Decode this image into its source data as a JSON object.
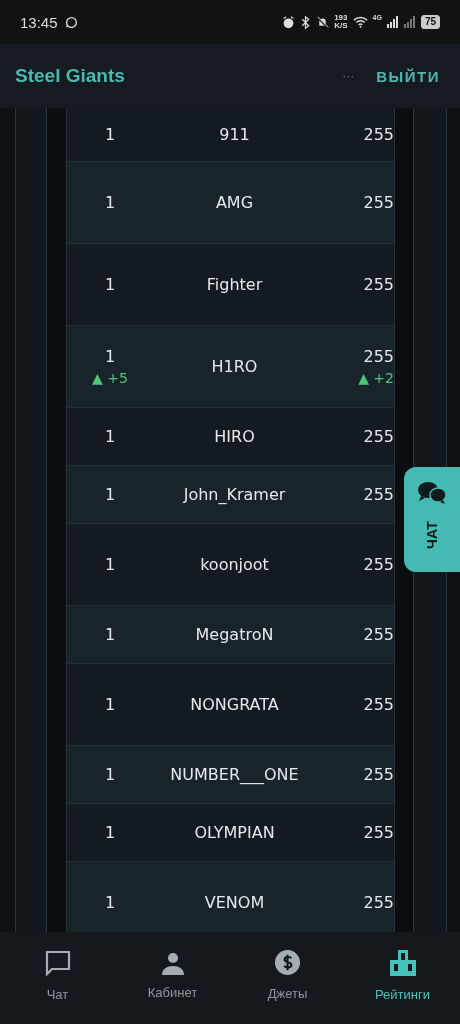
{
  "status_bar": {
    "time": "13:45",
    "speed": "193",
    "speed_unit": "K/S",
    "network": "4G",
    "battery": "75"
  },
  "header": {
    "title": "Steel Giants",
    "more": "···",
    "logout": "ВЫЙТИ"
  },
  "rows": [
    {
      "rank": "1",
      "name": "911",
      "score": "255",
      "tall": false
    },
    {
      "rank": "1",
      "name": "AMG",
      "score": "255",
      "tall": true
    },
    {
      "rank": "1",
      "name": "Fighter",
      "score": "255",
      "tall": true
    },
    {
      "rank": "1",
      "rank_change": "▲ +5",
      "name": "H1RO",
      "score": "255",
      "score_change": "▲ +2",
      "tall": true
    },
    {
      "rank": "1",
      "name": "HIRO",
      "score": "255",
      "tall": false
    },
    {
      "rank": "1",
      "name": "John_Kramer",
      "score": "255",
      "tall": false
    },
    {
      "rank": "1",
      "name": "koonjoot",
      "score": "255",
      "tall": true
    },
    {
      "rank": "1",
      "name": "MegatroN",
      "score": "255",
      "tall": false
    },
    {
      "rank": "1",
      "name": "NONGRATA",
      "score": "255",
      "tall": true
    },
    {
      "rank": "1",
      "name": "NUMBER___ONE",
      "score": "255",
      "tall": false
    },
    {
      "rank": "1",
      "name": "OLYMPIAN",
      "score": "255",
      "tall": false
    },
    {
      "rank": "1",
      "name": "VENOM",
      "score": "255",
      "tall": true
    }
  ],
  "chat_tab": {
    "label": "ЧАТ"
  },
  "nav": [
    {
      "label": "Чат",
      "selected": false
    },
    {
      "label": "Кабинет",
      "selected": false
    },
    {
      "label": "Джеты",
      "selected": false
    },
    {
      "label": "Рейтинги",
      "selected": true
    }
  ]
}
